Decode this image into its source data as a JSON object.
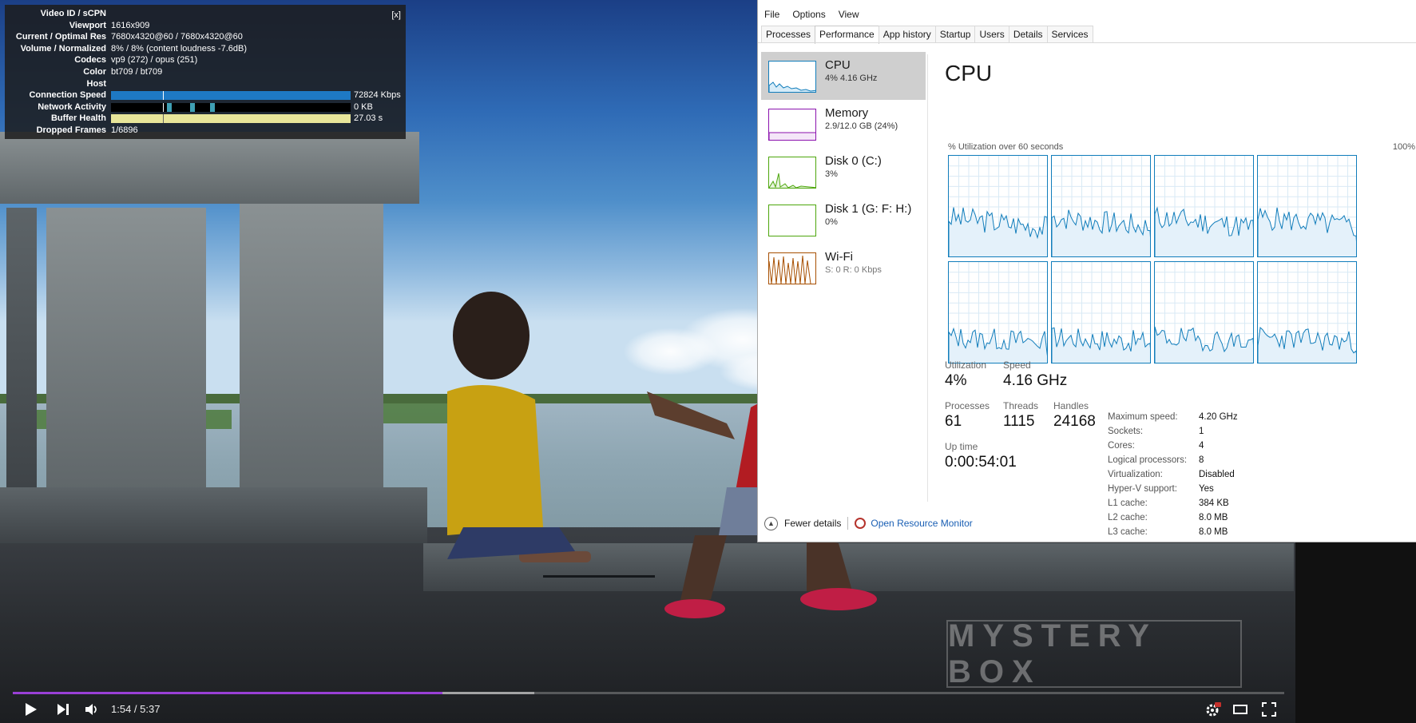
{
  "video": {
    "watermark": "MYSTERY BOX",
    "stats": {
      "close": "[x]",
      "rows": [
        {
          "key": "Video ID / sCPN",
          "value": ""
        },
        {
          "key": "Viewport",
          "value": "1616x909"
        },
        {
          "key": "Current / Optimal Res",
          "value": "7680x4320@60 / 7680x4320@60"
        },
        {
          "key": "Volume / Normalized",
          "value": "8% / 8% (content loudness -7.6dB)"
        },
        {
          "key": "Codecs",
          "value": "vp9 (272) / opus (251)"
        },
        {
          "key": "Color",
          "value": "bt709 / bt709"
        },
        {
          "key": "Host",
          "value": ""
        }
      ],
      "connection_speed": {
        "key": "Connection Speed",
        "value": "72824 Kbps",
        "fill": 1.0
      },
      "network_activity": {
        "key": "Network Activity",
        "value": "0 KB"
      },
      "buffer_health": {
        "key": "Buffer Health",
        "value": "27.03 s",
        "fill": 1.0
      },
      "dropped_frames": {
        "key": "Dropped Frames",
        "value": "1/6896"
      }
    },
    "controls": {
      "time": "1:54 / 5:37",
      "played_fraction": 0.338,
      "loaded_fraction": 0.41,
      "accent": "#9a40d6"
    }
  },
  "taskmanager": {
    "menu": [
      "File",
      "Options",
      "View"
    ],
    "tabs": [
      "Processes",
      "Performance",
      "App history",
      "Startup",
      "Users",
      "Details",
      "Services"
    ],
    "active_tab": "Performance",
    "sidebar": [
      {
        "title": "CPU",
        "sub": "4% 4.16 GHz",
        "color": "#117dbb",
        "active": true
      },
      {
        "title": "Memory",
        "sub": "2.9/12.0 GB (24%)",
        "color": "#8b12ae"
      },
      {
        "title": "Disk 0 (C:)",
        "sub": "3%",
        "color": "#4da60c"
      },
      {
        "title": "Disk 1 (G: F: H:)",
        "sub": "0%",
        "color": "#4da60c"
      },
      {
        "title": "Wi-Fi",
        "sub_prefix": "S: 0 R: 0 Kbps",
        "color": "#a74f01"
      }
    ],
    "cpu": {
      "title": "CPU",
      "axis_label": "% Utilization over 60 seconds",
      "axis_max": "100%",
      "utilization": {
        "label": "Utilization",
        "value": "4%"
      },
      "speed": {
        "label": "Speed",
        "value": "4.16 GHz"
      },
      "processes": {
        "label": "Processes",
        "value": "61"
      },
      "threads": {
        "label": "Threads",
        "value": "1115"
      },
      "handles": {
        "label": "Handles",
        "value": "24168"
      },
      "uptime": {
        "label": "Up time",
        "value": "0:00:54:01"
      },
      "specs": [
        {
          "k": "Maximum speed:",
          "v": "4.20 GHz"
        },
        {
          "k": "Sockets:",
          "v": "1"
        },
        {
          "k": "Cores:",
          "v": "4"
        },
        {
          "k": "Logical processors:",
          "v": "8"
        },
        {
          "k": "Virtualization:",
          "v": "Disabled"
        },
        {
          "k": "Hyper-V support:",
          "v": "Yes"
        },
        {
          "k": "L1 cache:",
          "v": "384 KB"
        },
        {
          "k": "L2 cache:",
          "v": "8.0 MB"
        },
        {
          "k": "L3 cache:",
          "v": "8.0 MB"
        }
      ]
    },
    "footer": {
      "fewer": "Fewer details",
      "monitor": "Open Resource Monitor"
    }
  }
}
